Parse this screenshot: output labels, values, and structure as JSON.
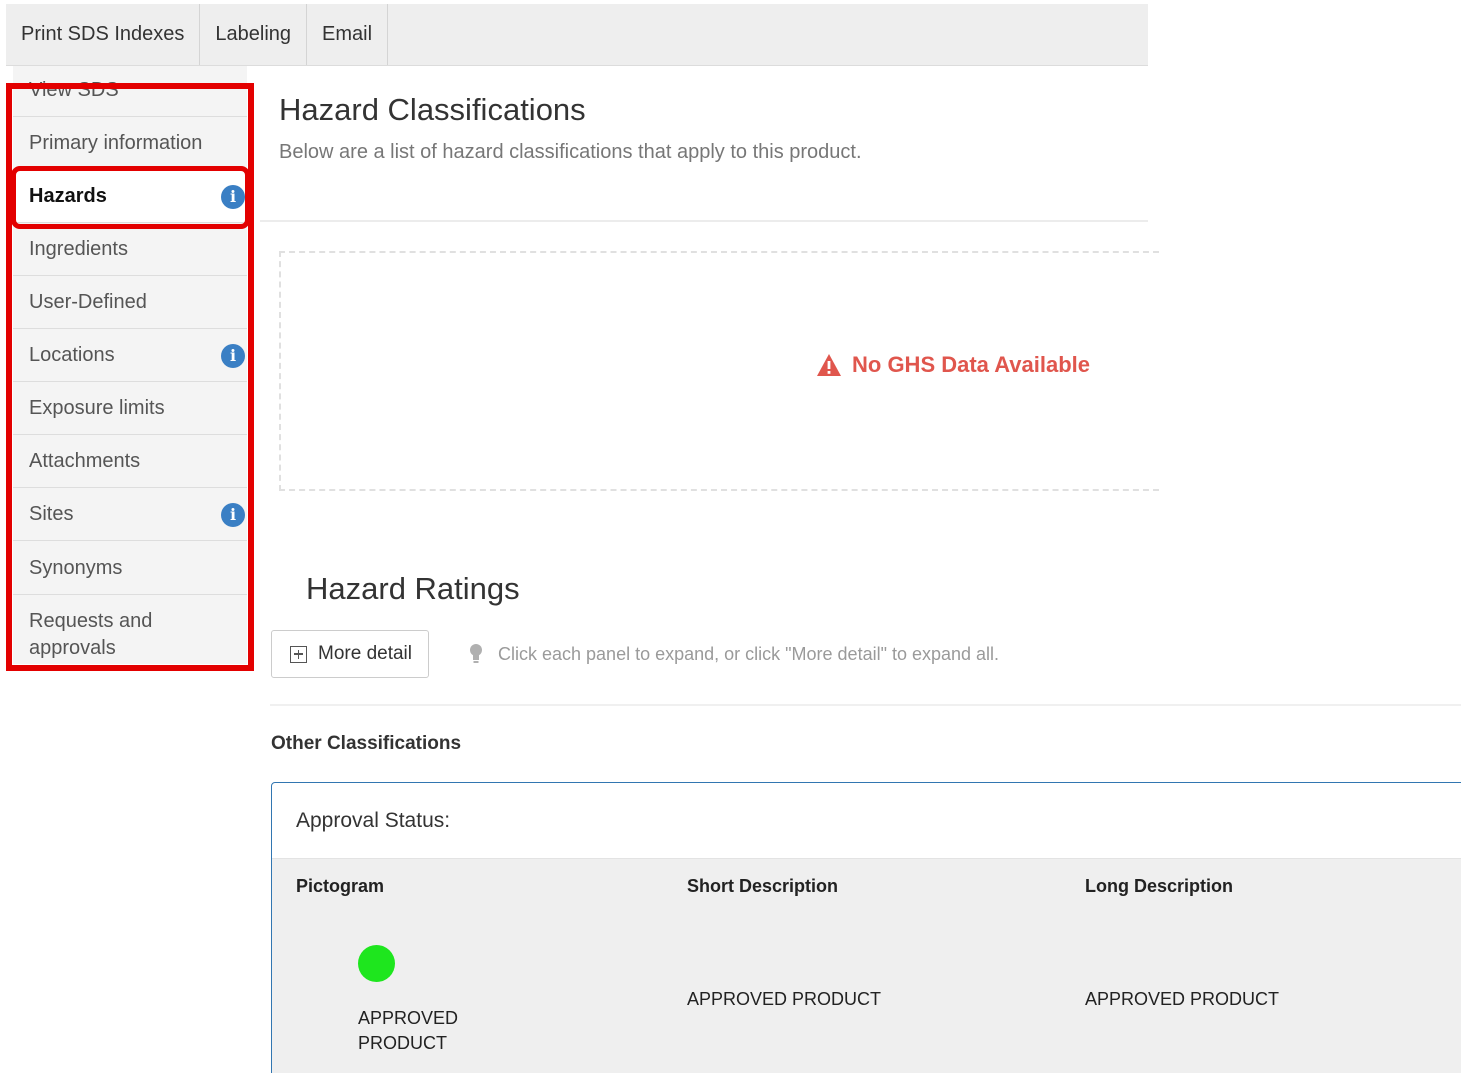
{
  "top_tabs": [
    "Print SDS Indexes",
    "Labeling",
    "Email"
  ],
  "sidebar": {
    "items": [
      {
        "label": "View SDS",
        "info": false
      },
      {
        "label": "Primary information",
        "info": false
      },
      {
        "label": "Hazards",
        "info": true,
        "active": true
      },
      {
        "label": "Ingredients",
        "info": false
      },
      {
        "label": "User-Defined",
        "info": false
      },
      {
        "label": "Locations",
        "info": true
      },
      {
        "label": "Exposure limits",
        "info": false
      },
      {
        "label": "Attachments",
        "info": false
      },
      {
        "label": "Sites",
        "info": true
      },
      {
        "label": "Synonyms",
        "info": false
      },
      {
        "label": "Requests and approvals",
        "info": false
      }
    ],
    "info_glyph": "i"
  },
  "main": {
    "title": "Hazard Classifications",
    "subtitle": "Below are a list of hazard classifications that apply to this product.",
    "no_data": "No GHS Data Available",
    "ratings_title": "Hazard Ratings",
    "more_detail": "More detail",
    "hint": "Click each panel to expand, or click \"More detail\" to expand all.",
    "other_title": "Other Classifications",
    "panel": {
      "heading": "Approval Status:",
      "columns": [
        "Pictogram",
        "Short Description",
        "Long Description"
      ],
      "row": {
        "pictogram_label": "APPROVED PRODUCT",
        "pictogram_line1": "APPROVED",
        "pictogram_line2": "PRODUCT",
        "short": "APPROVED PRODUCT",
        "long": "APPROVED PRODUCT"
      }
    }
  },
  "colors": {
    "highlight": "#e30000",
    "info": "#3a7fc4",
    "warning": "#e0564d",
    "approved_dot": "#1ee61e",
    "panel_border": "#3276b1"
  },
  "icons": [
    "info-icon",
    "warning-icon",
    "plus-square-icon",
    "lightbulb-icon",
    "status-dot-icon"
  ]
}
